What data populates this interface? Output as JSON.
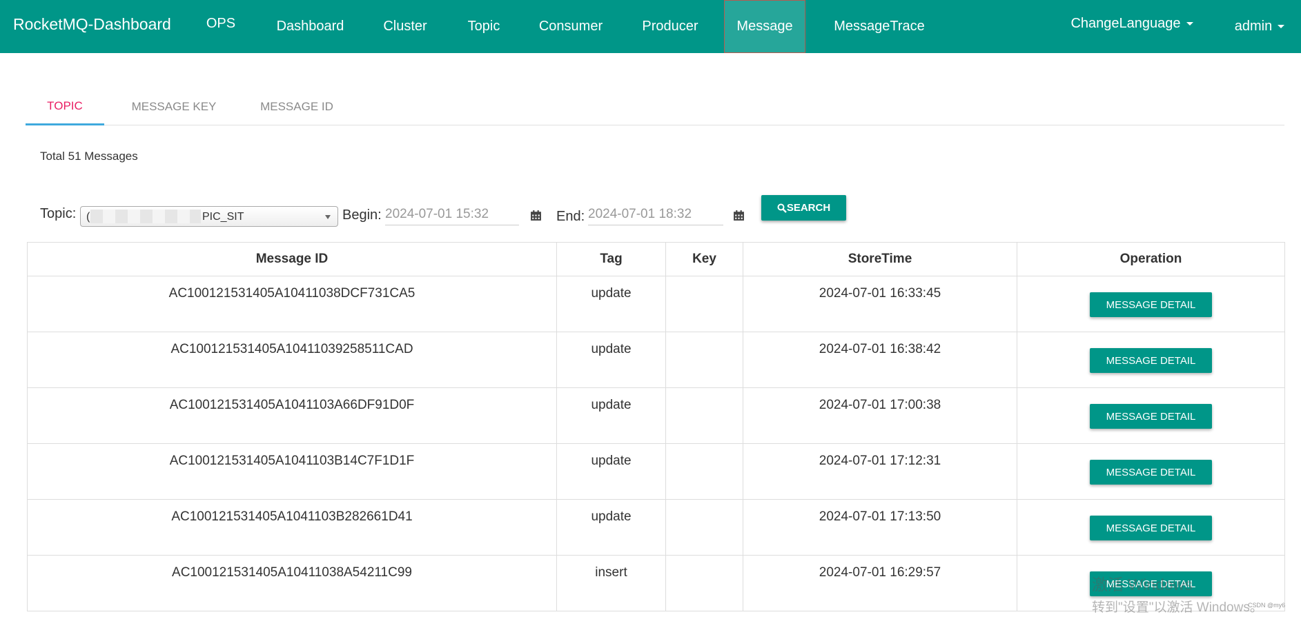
{
  "nav": {
    "brand": "RocketMQ-Dashboard",
    "items": [
      "OPS",
      "Dashboard",
      "Cluster",
      "Topic",
      "Consumer",
      "Producer",
      "Message",
      "MessageTrace"
    ],
    "active": "Message",
    "language": "ChangeLanguage",
    "user": "admin"
  },
  "tabs": {
    "items": [
      "TOPIC",
      "MESSAGE KEY",
      "MESSAGE ID"
    ],
    "active": "TOPIC"
  },
  "total_text": "Total 51 Messages",
  "search": {
    "topic_label": "Topic:",
    "topic_prefix": "(",
    "topic_value": "PIC_SIT",
    "begin_label": "Begin:",
    "begin_value": "2024-07-01 15:32",
    "end_label": "End:",
    "end_value": "2024-07-01 18:32",
    "button_label": "SEARCH"
  },
  "table": {
    "headers": [
      "Message ID",
      "Tag",
      "Key",
      "StoreTime",
      "Operation"
    ],
    "rows": [
      {
        "id": "AC100121531405A10411038DCF731CA5",
        "tag": "update",
        "key": "",
        "store_time": "2024-07-01 16:33:45",
        "op": "MESSAGE DETAIL"
      },
      {
        "id": "AC100121531405A10411039258511CAD",
        "tag": "update",
        "key": "",
        "store_time": "2024-07-01 16:38:42",
        "op": "MESSAGE DETAIL"
      },
      {
        "id": "AC100121531405A1041103A66DF91D0F",
        "tag": "update",
        "key": "",
        "store_time": "2024-07-01 17:00:38",
        "op": "MESSAGE DETAIL"
      },
      {
        "id": "AC100121531405A1041103B14C7F1D1F",
        "tag": "update",
        "key": "",
        "store_time": "2024-07-01 17:12:31",
        "op": "MESSAGE DETAIL"
      },
      {
        "id": "AC100121531405A1041103B282661D41",
        "tag": "update",
        "key": "",
        "store_time": "2024-07-01 17:13:50",
        "op": "MESSAGE DETAIL"
      },
      {
        "id": "AC100121531405A10411038A54211C99",
        "tag": "insert",
        "key": "",
        "store_time": "2024-07-01 16:29:57",
        "op": "MESSAGE DETAIL"
      }
    ]
  },
  "watermark": {
    "line1": "激活 Windows",
    "line2": "转到\"设置\"以激活 Windows。",
    "csdn": "CSDN @my6"
  },
  "colors": {
    "primary": "#009688",
    "active_nav": "#26a69a",
    "active_tab_text": "#e91e63",
    "active_tab_underline": "#3fa9dd"
  }
}
